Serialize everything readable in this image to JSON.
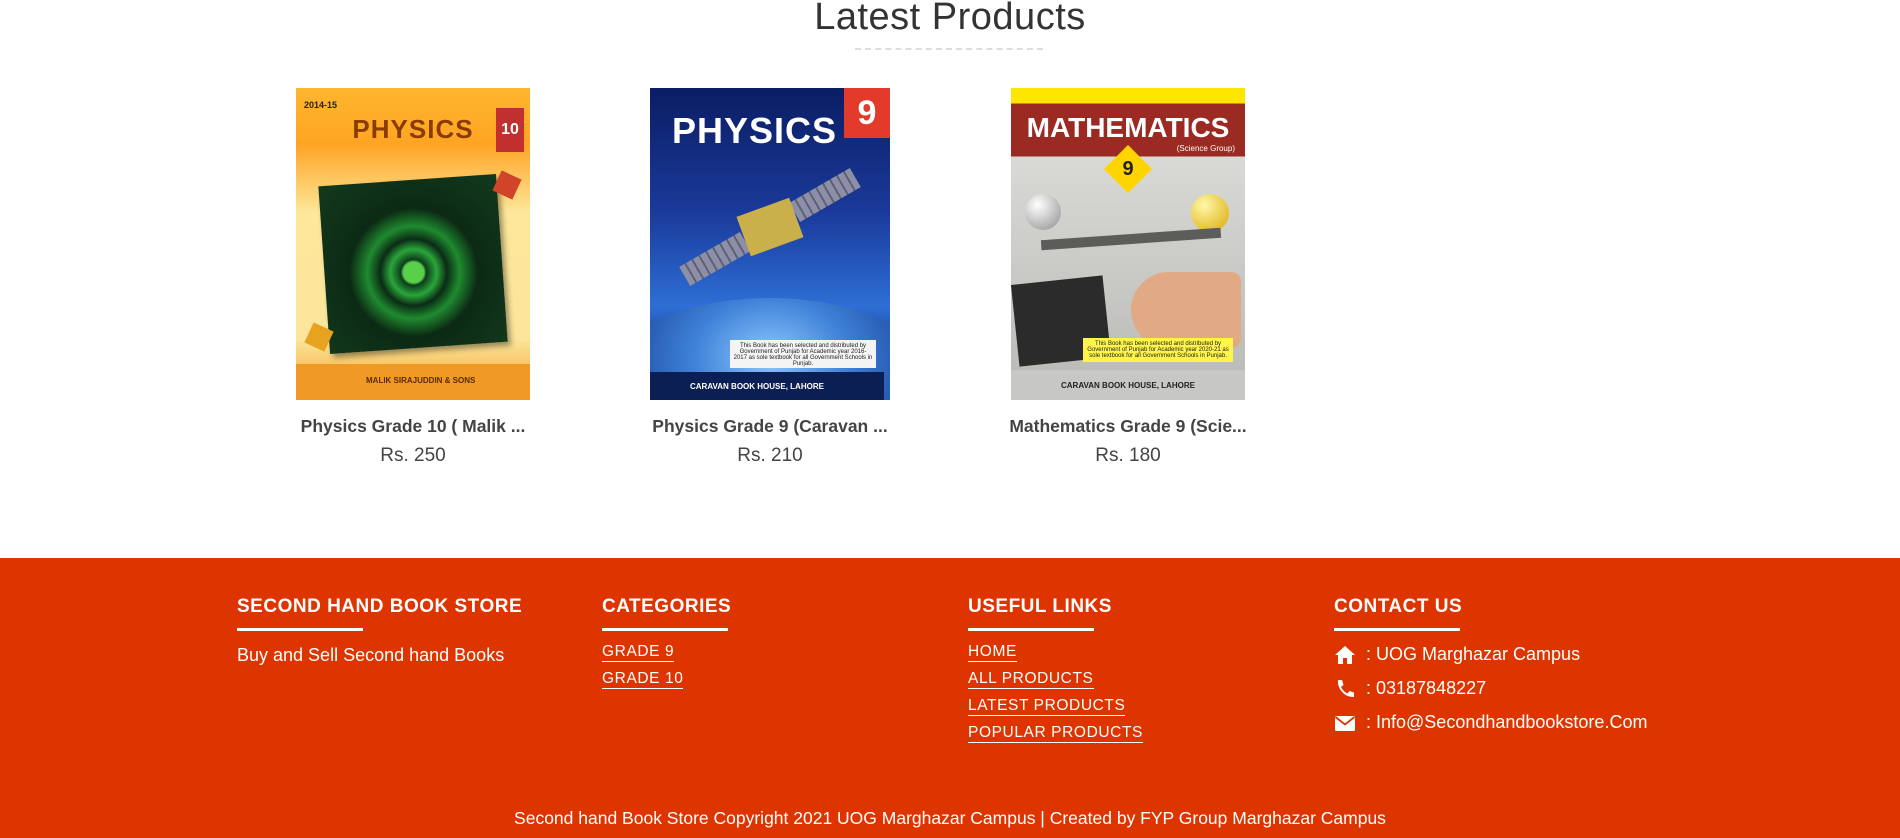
{
  "latest": {
    "title": "Latest Products",
    "products": [
      {
        "name": "Physics Grade 10 ( Malik ...",
        "price": "Rs. 250",
        "cover": {
          "year": "2014-15",
          "title": "PHYSICS",
          "grade": "10",
          "publisher": "MALIK SIRAJUDDIN & SONS"
        }
      },
      {
        "name": "Physics Grade 9 (Caravan ...",
        "price": "Rs. 210",
        "cover": {
          "title": "PHYSICS",
          "grade": "9",
          "publisher": "CARAVAN BOOK HOUSE, LAHORE",
          "note": "This Book has been selected and distributed by Government of Punjab for Academic year 2016-2017 as sole textbook for all Government Schools in Punjab."
        }
      },
      {
        "name": "Mathematics Grade 9 (Scie...",
        "price": "Rs. 180",
        "cover": {
          "title": "MATHEMATICS",
          "subtitle": "(Science Group)",
          "grade": "9",
          "publisher": "CARAVAN BOOK HOUSE, LAHORE",
          "note": "This Book has been selected and distributed by Government of Punjab for Academic year 2020-21 as sole textbook for all Government Schools in Punjab."
        }
      }
    ]
  },
  "footer": {
    "about": {
      "heading": "SECOND HAND BOOK STORE",
      "text": "Buy and Sell Second hand Books"
    },
    "categories": {
      "heading": "CATEGORIES",
      "links": [
        "GRADE 9",
        "GRADE 10"
      ]
    },
    "useful": {
      "heading": "USEFUL LINKS",
      "links": [
        "HOME",
        "ALL PRODUCTS",
        "LATEST PRODUCTS",
        "POPULAR PRODUCTS"
      ]
    },
    "contact": {
      "heading": "CONTACT US",
      "rows": [
        {
          "icon": "home-icon",
          "text": ": UOG Marghazar Campus"
        },
        {
          "icon": "phone-icon",
          "text": ": 03187848227"
        },
        {
          "icon": "envelope-icon",
          "text": ": Info@Secondhandbookstore.Com"
        }
      ]
    },
    "copyright": "Second hand Book Store Copyright 2021 UOG Marghazar Campus | Created by FYP Group Marghazar Campus"
  },
  "colors": {
    "footer_bg": "#de3500",
    "text": "#444444"
  }
}
